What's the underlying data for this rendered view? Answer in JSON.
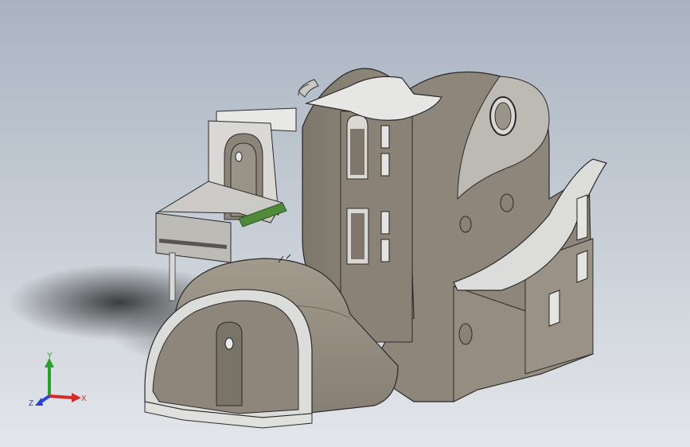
{
  "viewport": {
    "model": "house-assembly",
    "colors": {
      "background_top": "#a9b3c1",
      "background_bottom": "#e3e6ea",
      "concrete": "#8e867a",
      "concrete_dark": "#6e675d",
      "slab": "#e6e6e4",
      "edge": "#2a2a2a",
      "grass": "#4f8a3a"
    }
  },
  "triad": {
    "x_label": "X",
    "y_label": "Y",
    "z_label": "Z",
    "x_color": "#d42a2a",
    "y_color": "#2aa02a",
    "z_color": "#2a44d4"
  }
}
